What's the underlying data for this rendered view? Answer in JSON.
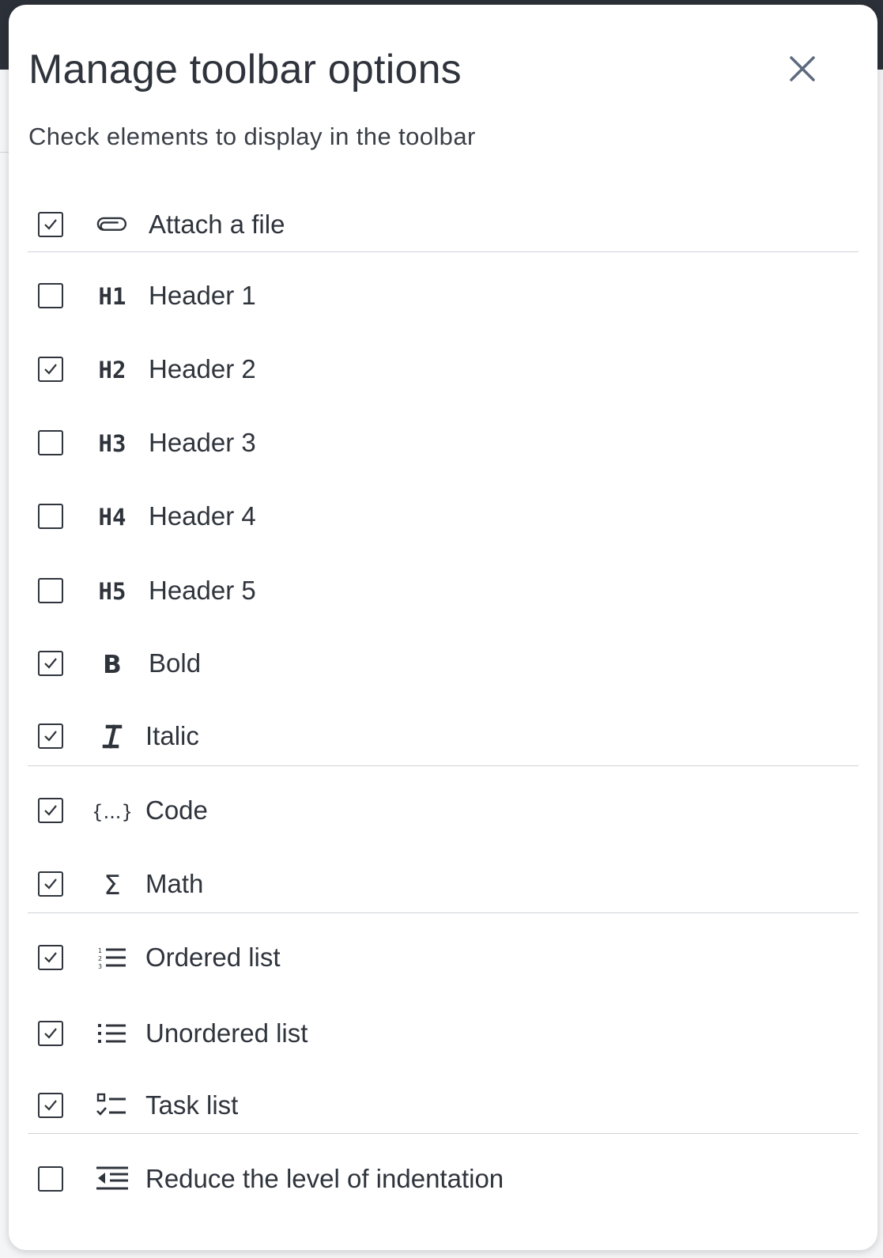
{
  "dialog": {
    "title": "Manage toolbar options",
    "subtitle": "Check elements to display in the toolbar",
    "close_icon": "close-icon"
  },
  "options": [
    {
      "label": "Attach a file",
      "icon": "paperclip-icon",
      "checked": true
    },
    {
      "label": "Header 1",
      "icon": "h1-icon",
      "icon_text": "H1",
      "checked": false
    },
    {
      "label": "Header 2",
      "icon": "h2-icon",
      "icon_text": "H2",
      "checked": true
    },
    {
      "label": "Header 3",
      "icon": "h3-icon",
      "icon_text": "H3",
      "checked": false
    },
    {
      "label": "Header 4",
      "icon": "h4-icon",
      "icon_text": "H4",
      "checked": false
    },
    {
      "label": "Header 5",
      "icon": "h5-icon",
      "icon_text": "H5",
      "checked": false
    },
    {
      "label": "Bold",
      "icon": "bold-icon",
      "icon_text": "B",
      "checked": true
    },
    {
      "label": "Italic",
      "icon": "italic-icon",
      "checked": true
    },
    {
      "label": "Code",
      "icon": "code-braces-icon",
      "icon_text": "{...}",
      "checked": true
    },
    {
      "label": "Math",
      "icon": "sigma-icon",
      "icon_text": "Σ",
      "checked": true
    },
    {
      "label": "Ordered list",
      "icon": "ordered-list-icon",
      "checked": true
    },
    {
      "label": "Unordered list",
      "icon": "unordered-list-icon",
      "checked": true
    },
    {
      "label": "Task list",
      "icon": "task-list-icon",
      "checked": true
    },
    {
      "label": "Reduce the level of indentation",
      "icon": "outdent-icon",
      "checked": false
    }
  ],
  "colors": {
    "text": "#2f343c",
    "separator": "#cfd2d6",
    "dialog_bg": "#ffffff",
    "backdrop_topbar": "#2c3038"
  }
}
